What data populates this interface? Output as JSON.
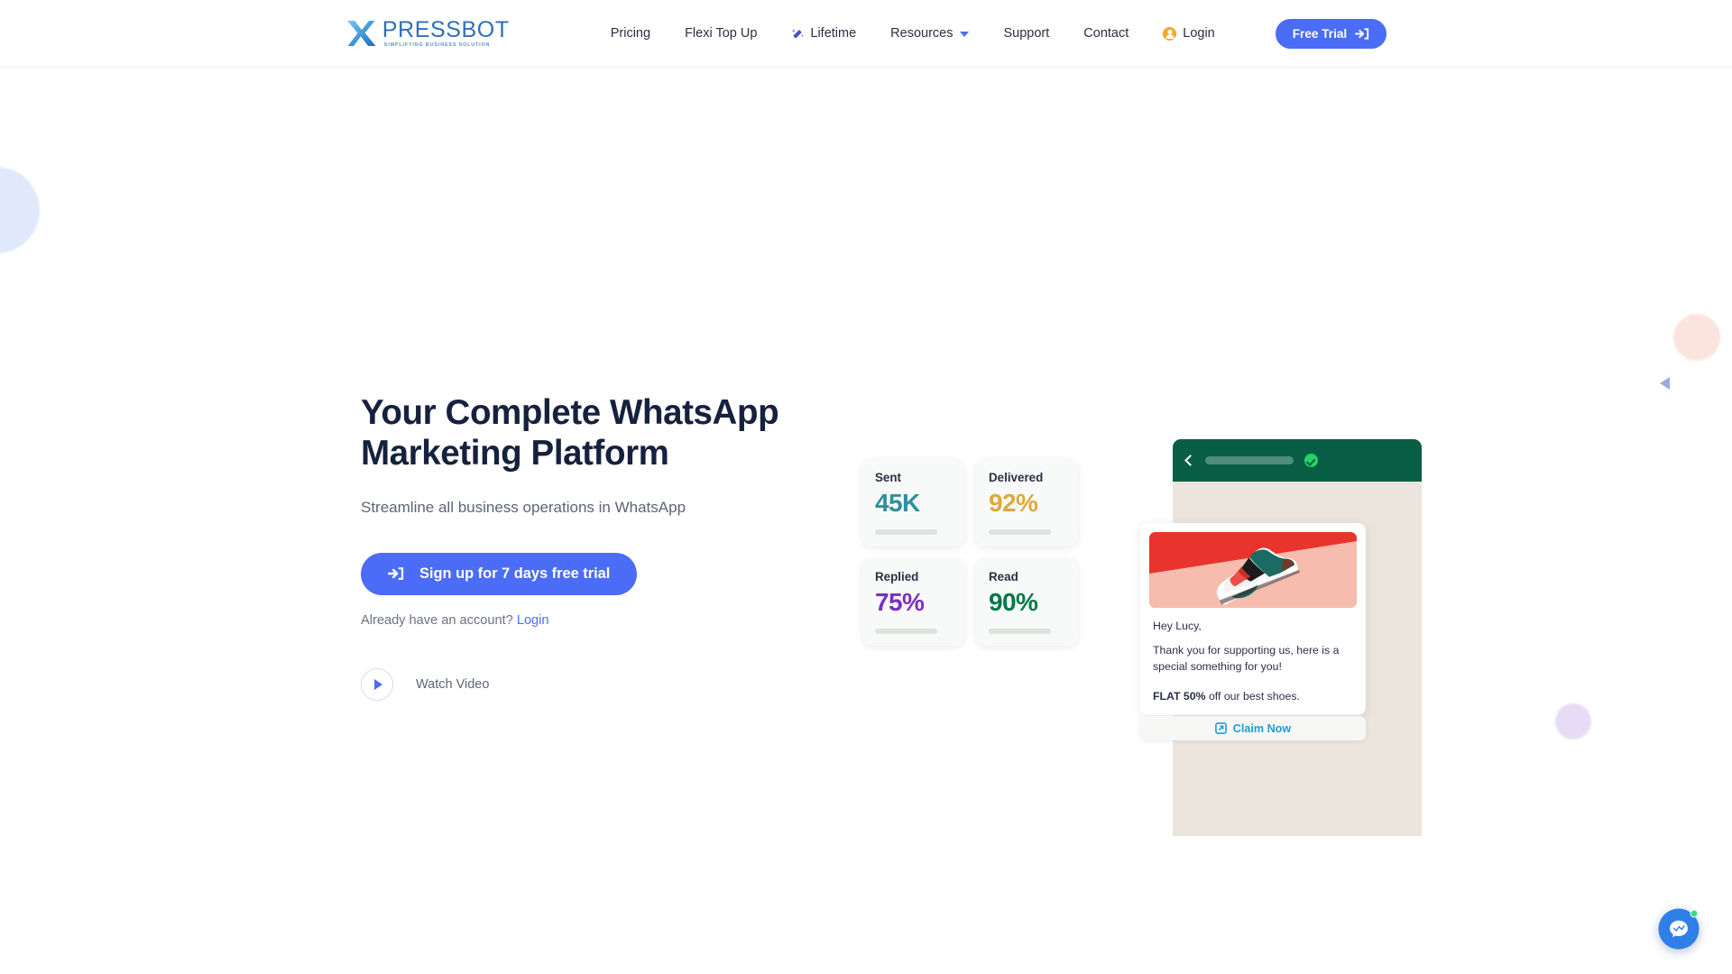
{
  "header": {
    "logo": {
      "name": "PRESSBOT",
      "tagline": "SIMPLIFYING BUSINESS SOLUTION",
      "mark": "x-logo-icon"
    },
    "nav": [
      {
        "label": "Pricing",
        "icon": null,
        "dropdown": false
      },
      {
        "label": "Flexi Top Up",
        "icon": null,
        "dropdown": false
      },
      {
        "label": "Lifetime",
        "icon": "magic-wand-icon",
        "dropdown": false
      },
      {
        "label": "Resources",
        "icon": null,
        "dropdown": true
      },
      {
        "label": "Support",
        "icon": null,
        "dropdown": false
      },
      {
        "label": "Contact",
        "icon": null,
        "dropdown": false
      }
    ],
    "login": {
      "label": "Login",
      "icon": "user-circle-icon"
    },
    "free_trial": {
      "label": "Free Trial",
      "icon": "sign-in-icon"
    }
  },
  "hero": {
    "title": "Your Complete WhatsApp\nMarketing Platform",
    "subtitle": "Streamline all business operations in WhatsApp",
    "cta": {
      "label": "Sign up for 7 days free trial",
      "icon": "sign-in-icon"
    },
    "account_prompt": "Already have an account?",
    "account_link": "Login",
    "watch_video": {
      "label": "Watch Video",
      "icon": "play-icon"
    }
  },
  "stats": [
    {
      "label": "Sent",
      "value": "45K",
      "color": "#2f8f9d"
    },
    {
      "label": "Delivered",
      "value": "92%",
      "color": "#dfa93c"
    },
    {
      "label": "Replied",
      "value": "75%",
      "color": "#7b2fbe"
    },
    {
      "label": "Read",
      "value": "90%",
      "color": "#00794a"
    }
  ],
  "phone": {
    "header": {
      "back_icon": "back-chevron-icon",
      "contact_placeholder": "",
      "verified_icon": "verified-badge-icon"
    },
    "message": {
      "image_alt": "sneaker-product-photo",
      "greeting": "Hey Lucy,",
      "body": "Thank you for supporting us, here is a special something for you!",
      "offer_bold": "FLAT 50%",
      "offer_rest": " off our best shoes."
    },
    "claim": {
      "label": "Claim Now",
      "icon": "external-link-icon"
    }
  },
  "chat_widget": {
    "icon": "chat-bubble-icon",
    "online": true
  },
  "colors": {
    "primary_blue": "#4a6cf7",
    "headline_navy": "#16213e",
    "whatsapp_green": "#075e44",
    "verified_green": "#25d366",
    "claim_blue": "#1a9ed4",
    "login_orange": "#f5a623"
  }
}
